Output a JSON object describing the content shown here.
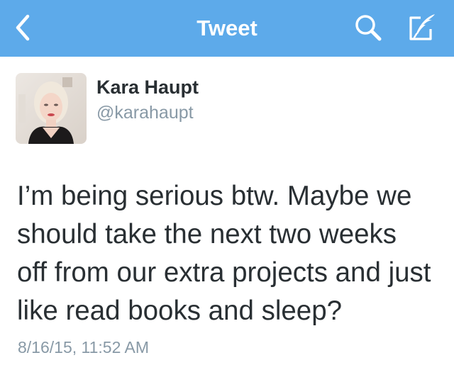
{
  "nav": {
    "title": "Tweet",
    "back_icon": "chevron-left-icon",
    "search_icon": "search-icon",
    "compose_icon": "compose-icon",
    "bar_color": "#5daaea"
  },
  "tweet": {
    "author_name": "Kara Haupt",
    "author_handle": "@karahaupt",
    "text": "I’m being serious btw. Maybe we\nshould take the next two weeks\noff from our extra projects and just\nlike read books and sleep?",
    "timestamp": "8/16/15, 11:52 AM"
  }
}
